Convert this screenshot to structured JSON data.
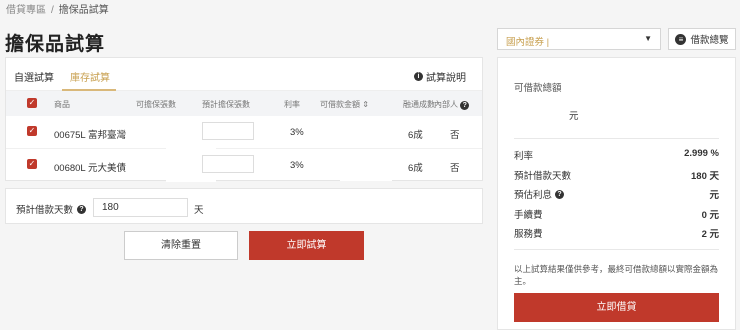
{
  "breadcrumb": {
    "parent": "借貸專區",
    "separator": "/",
    "current": "擔保品試算"
  },
  "page_title": "擔保品試算",
  "tabs": [
    {
      "label": "自選試算",
      "active": false
    },
    {
      "label": "庫存試算",
      "active": true
    }
  ],
  "help_label": "試算說明",
  "table": {
    "headers": [
      "商品",
      "可擔保張數",
      "預計擔保張數",
      "利率",
      "可借款金額",
      "融通成數",
      "內部人"
    ],
    "rows": [
      {
        "product": "00675L 富邦臺灣",
        "available": "",
        "planned": "",
        "rate": "3%",
        "amount": "",
        "ratio": "6成",
        "insider": "否"
      },
      {
        "product": "00680L 元大美債",
        "available": "",
        "planned": "",
        "rate": "3%",
        "amount": "",
        "ratio": "6成",
        "insider": "否"
      }
    ]
  },
  "days": {
    "label": "預計借款天數",
    "value": "180",
    "unit": "天"
  },
  "buttons": {
    "clear": "清除重置",
    "calculate": "立即試算",
    "borrow": "立即借貸"
  },
  "loan_select": {
    "value": "國內證券 |"
  },
  "overview_label": "借款總覽",
  "summary": {
    "total_label": "可借款總額",
    "total_unit": "元",
    "rows": [
      {
        "label": "利率",
        "value": "2.999 %"
      },
      {
        "label": "預計借款天數",
        "value": "180 天"
      },
      {
        "label": "預估利息",
        "value": "元"
      },
      {
        "label": "手續費",
        "value": "0 元"
      },
      {
        "label": "服務費",
        "value": "2 元"
      }
    ],
    "note": "以上試算結果僅供參考，最終可借款總額以實際金額為主。"
  },
  "colors": {
    "accent": "#c0392b",
    "tab_active": "#c8a050",
    "page_bg": "#f5f5f5"
  }
}
